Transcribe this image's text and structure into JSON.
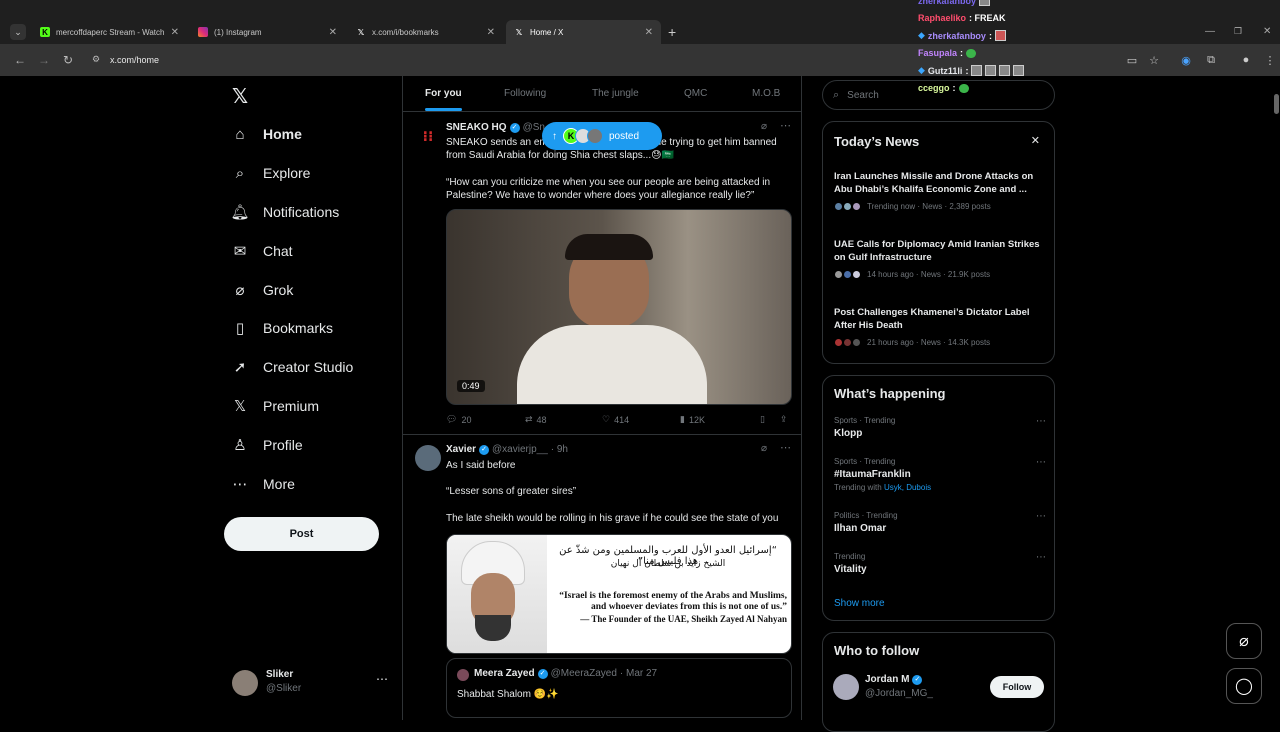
{
  "browser": {
    "tabs": [
      {
        "label": "mercoffdaperc Stream - Watch",
        "icon": "kick-icon",
        "active": false
      },
      {
        "label": "(1) Instagram",
        "icon": "instagram-icon",
        "active": false
      },
      {
        "label": "x.com/i/bookmarks",
        "icon": "x-icon",
        "active": false
      },
      {
        "label": "Home / X",
        "icon": "x-icon",
        "active": true
      }
    ],
    "url": "x.com/home"
  },
  "stream_chat": [
    {
      "user": "zherkafanboy",
      "message": "",
      "color": "#7b68ee"
    },
    {
      "user": "Raphaeliko",
      "message": ": FREAK",
      "color": "#ff4d6d"
    },
    {
      "user": "zherkafanboy",
      "message": ":",
      "color": "#a78bfa"
    },
    {
      "user": "Fasupala",
      "message": ":",
      "color": "#c084fc"
    },
    {
      "user": "Gutz11li",
      "message": ":",
      "color": "#e5e7eb"
    },
    {
      "user": "cceggo",
      "message": ":",
      "color": "#d9f99d"
    }
  ],
  "sidebar": {
    "items": [
      {
        "label": "Home",
        "icon": "home-icon"
      },
      {
        "label": "Explore",
        "icon": "search-icon"
      },
      {
        "label": "Notifications",
        "icon": "bell-icon"
      },
      {
        "label": "Chat",
        "icon": "mail-icon"
      },
      {
        "label": "Grok",
        "icon": "grok-icon"
      },
      {
        "label": "Bookmarks",
        "icon": "bookmark-icon"
      },
      {
        "label": "Creator Studio",
        "icon": "rocket-icon"
      },
      {
        "label": "Premium",
        "icon": "x-icon"
      },
      {
        "label": "Profile",
        "icon": "person-icon"
      },
      {
        "label": "More",
        "icon": "more-circle-icon"
      }
    ],
    "post_label": "Post",
    "account": {
      "name": "Sliker",
      "handle": "@Sliker"
    }
  },
  "feed": {
    "tabs": [
      "For you",
      "Following",
      "The jungle",
      "QMC",
      "M.O.B"
    ],
    "posted_pill": "posted",
    "tweets": [
      {
        "name": "SNEAKO HQ",
        "handle": "@Sn",
        "text1": "SNEAKO sends an em                                  eople trying to get him banned from Saudi Arabia for doing Shia chest slaps...😓🇸🇦",
        "text2": "“How can you criticize me when you see our people are being attacked in Palestine? We have to wonder where does your allegiance really lie?”",
        "video_duration": "0:49",
        "replies": "20",
        "reposts": "48",
        "likes": "414",
        "views": "12K"
      },
      {
        "name": "Xavier",
        "handle": "@xavierjp__",
        "time": "· 9h",
        "text1": "As I said before",
        "text2": "“Lesser sons of greater sires”",
        "text3": "The late sheikh would be rolling in his grave if he could see the state of you",
        "image_arabic": "“إسرائيل العدو الأول للعرب والمسلمين ومن شذّ عن هذا فليس منا”",
        "image_arabic2": "الشيخ زايد بن سلطان آل نهيان",
        "image_quote": "“Israel is the foremost enemy of the Arabs and Muslims, and whoever deviates from this is not one of us.”",
        "image_attrib": "— The Founder of the UAE, Sheikh Zayed Al Nahyan",
        "quote": {
          "name": "Meera Zayed",
          "handle": "@MeeraZayed",
          "time": "· Mar 27",
          "text": "Shabbat Shalom ☺️✨"
        }
      }
    ]
  },
  "right": {
    "search_placeholder": "Search",
    "news_title": "Today’s News",
    "news": [
      {
        "title": "Iran Launches Missile and Drone Attacks on Abu Dhabi’s Khalifa Economic Zone and ...",
        "meta": "Trending now · News · 2,389 posts"
      },
      {
        "title": "UAE Calls for Diplomacy Amid Iranian Strikes on Gulf Infrastructure",
        "meta": "14 hours ago · News · 21.9K posts"
      },
      {
        "title": "Post Challenges Khamenei’s Dictator Label After His Death",
        "meta": "21 hours ago · News · 14.3K posts"
      }
    ],
    "happening_title": "What’s happening",
    "trends": [
      {
        "context": "Sports · Trending",
        "name": "Klopp",
        "with": ""
      },
      {
        "context": "Sports · Trending",
        "name": "#ItaumaFranklin",
        "with": "Trending with",
        "with_links": "Usyk, Dubois"
      },
      {
        "context": "Politics · Trending",
        "name": "Ilhan Omar",
        "with": ""
      },
      {
        "context": "Trending",
        "name": "Vitality",
        "with": ""
      }
    ],
    "show_more": "Show more",
    "follow_title": "Who to follow",
    "follow": {
      "name": "Jordan M",
      "handle": "@Jordan_MG_",
      "button": "Follow"
    }
  },
  "colors": {
    "accent": "#1d9bf0",
    "background": "#000000",
    "border": "#2f3336",
    "muted": "#71767b"
  }
}
